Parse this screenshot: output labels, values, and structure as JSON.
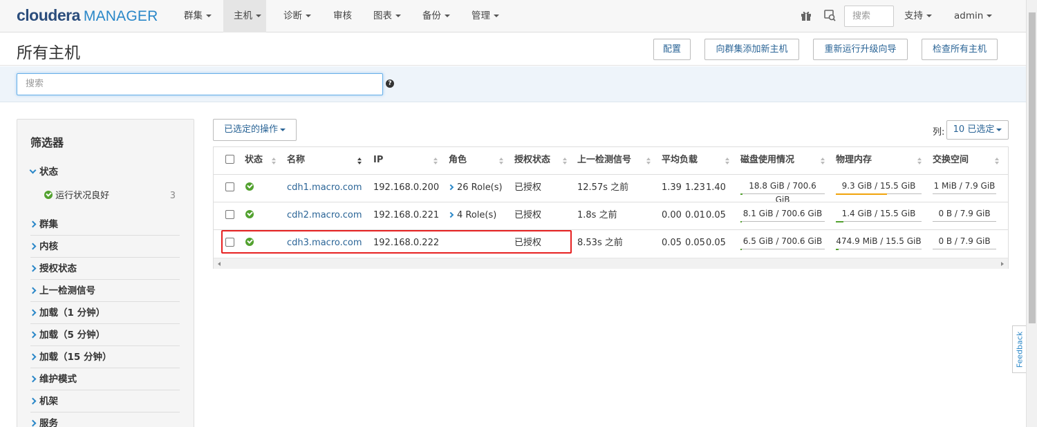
{
  "nav": {
    "logo_brand": "cloudera",
    "logo_product": "MANAGER",
    "items": [
      {
        "label": "群集",
        "caret": true
      },
      {
        "label": "主机",
        "caret": true,
        "active": true
      },
      {
        "label": "诊断",
        "caret": true
      },
      {
        "label": "审核",
        "caret": false
      },
      {
        "label": "图表",
        "caret": true
      },
      {
        "label": "备份",
        "caret": true
      },
      {
        "label": "管理",
        "caret": true
      }
    ],
    "search_placeholder": "搜索",
    "support": "支持",
    "user": "admin"
  },
  "header": {
    "title": "所有主机",
    "buttons": [
      "配置",
      "向群集添加新主机",
      "重新运行升级向导",
      "检查所有主机"
    ]
  },
  "search": {
    "placeholder": "搜索"
  },
  "sidebar": {
    "title": "筛选器",
    "status_label": "状态",
    "status_sub": {
      "label": "运行状况良好",
      "count": "3"
    },
    "groups": [
      "群集",
      "内核",
      "授权状态",
      "上一检测信号",
      "加载（1 分钟）",
      "加载（5 分钟）",
      "加载（15 分钟）",
      "维护模式",
      "机架",
      "服务"
    ]
  },
  "toolbar": {
    "selected_actions": "已选定的操作",
    "columns_label": "列:",
    "columns_selected": "10 已选定"
  },
  "table": {
    "headers": [
      "状态",
      "名称",
      "IP",
      "角色",
      "授权状态",
      "上一检测信号",
      "平均负载",
      "磁盘使用情况",
      "物理内存",
      "交换空间"
    ],
    "rows": [
      {
        "name": "cdh1.macro.com",
        "ip": "192.168.0.200",
        "roles": "26 Role(s)",
        "auth": "已授权",
        "heartbeat": "12.57s 之前",
        "load": [
          "1.39",
          "1.23",
          "1.40"
        ],
        "disk": "18.8 GiB / 700.6 GiB",
        "disk_frac": 0.027,
        "mem": "9.3 GiB / 15.5 GiB",
        "mem_frac": 0.6,
        "swap": "1 MiB / 7.9 GiB",
        "swap_frac": 0.0
      },
      {
        "name": "cdh2.macro.com",
        "ip": "192.168.0.221",
        "roles": "4 Role(s)",
        "auth": "已授权",
        "heartbeat": "1.8s 之前",
        "load": [
          "0.00",
          "0.01",
          "0.05"
        ],
        "disk": "8.1 GiB / 700.6 GiB",
        "disk_frac": 0.012,
        "mem": "1.4 GiB / 15.5 GiB",
        "mem_frac": 0.09,
        "swap": "0 B / 7.9 GiB",
        "swap_frac": 0.0
      },
      {
        "name": "cdh3.macro.com",
        "ip": "192.168.0.222",
        "roles": "",
        "auth": "已授权",
        "heartbeat": "8.53s 之前",
        "load": [
          "0.05",
          "0.05",
          "0.05"
        ],
        "disk": "6.5 GiB / 700.6 GiB",
        "disk_frac": 0.009,
        "mem": "474.9 MiB / 15.5 GiB",
        "mem_frac": 0.03,
        "swap": "0 B / 7.9 GiB",
        "swap_frac": 0.0
      }
    ]
  },
  "feedback": "Feedback",
  "colors": {
    "link": "#2a6496",
    "ok": "#52a12f",
    "mem_high": "#f0a30a",
    "bar_low": "#52a12f",
    "highlight": "#e62020"
  }
}
